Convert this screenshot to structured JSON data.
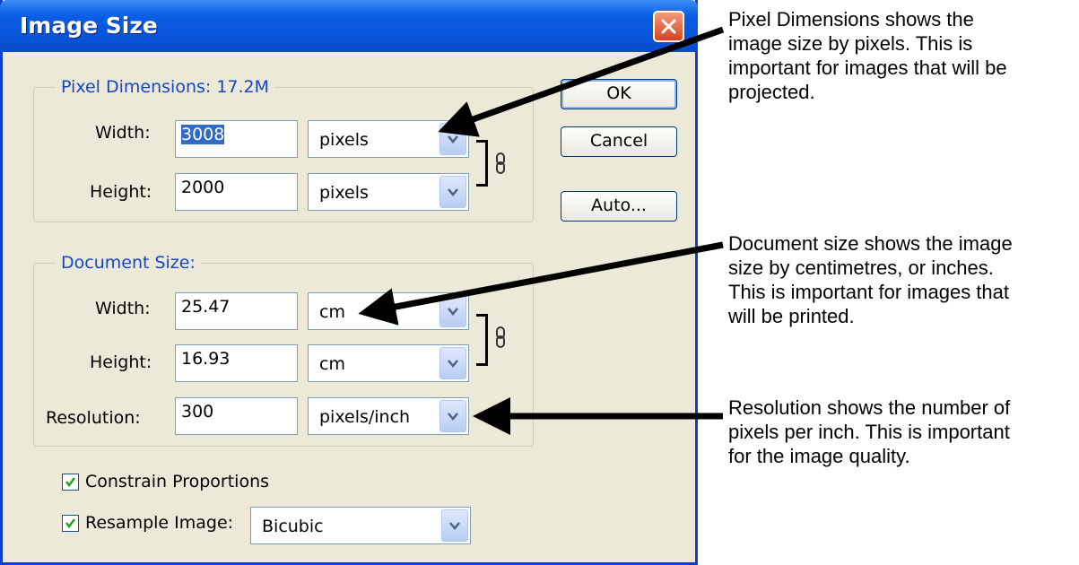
{
  "dialog": {
    "title": "Image Size",
    "pixel_dimensions": {
      "legend": "Pixel Dimensions:  17.2M",
      "width_label": "Width:",
      "width_value": "3008",
      "width_unit": "pixels",
      "height_label": "Height:",
      "height_value": "2000",
      "height_unit": "pixels"
    },
    "document_size": {
      "legend": "Document Size:",
      "width_label": "Width:",
      "width_value": "25.47",
      "width_unit": "cm",
      "height_label": "Height:",
      "height_value": "16.93",
      "height_unit": "cm",
      "resolution_label": "Resolution:",
      "resolution_value": "300",
      "resolution_unit": "pixels/inch"
    },
    "constrain_label": "Constrain Proportions",
    "constrain_checked": true,
    "resample_label": "Resample Image:",
    "resample_checked": true,
    "resample_value": "Bicubic",
    "buttons": {
      "ok": "OK",
      "cancel": "Cancel",
      "auto": "Auto..."
    }
  },
  "annotations": {
    "pixel_lines": [
      "Pixel Dimensions shows the",
      "image size by pixels. This is",
      "important for images that will be",
      "projected."
    ],
    "document_lines": [
      "Document size shows the image",
      "size by centimetres, or inches.",
      "This is important for images that",
      "will be printed."
    ],
    "resolution_lines": [
      "Resolution shows the number of",
      "pixels per inch. This is important",
      "for the image quality."
    ]
  },
  "colors": {
    "titlebar": "#0853d8",
    "legend": "#1546c8",
    "dialog_bg": "#ece9d8",
    "close": "#d8431d"
  }
}
